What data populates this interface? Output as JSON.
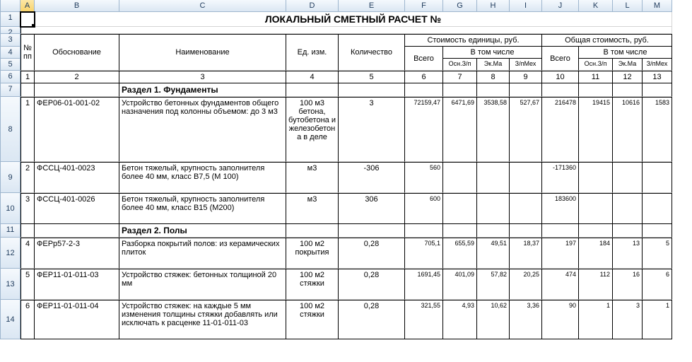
{
  "cols": [
    "A",
    "B",
    "C",
    "D",
    "E",
    "F",
    "G",
    "H",
    "I",
    "J",
    "K",
    "L",
    "M"
  ],
  "active_col": "A",
  "title": "ЛОКАЛЬНЫЙ СМЕТНЫЙ РАСЧЕТ №",
  "headers": {
    "num": "№ пп",
    "just": "Обоснование",
    "name": "Наименование",
    "unit": "Ед. изм.",
    "qty": "Количество",
    "cost_unit": "Стоимость единицы, руб.",
    "cost_total": "Общая стоимость, руб.",
    "total": "Всего",
    "incl": "В том числе",
    "osn": "Осн.З/п",
    "ekm": "Эк.Ма",
    "zpm": "З/пМех"
  },
  "colnums": [
    "1",
    "2",
    "3",
    "4",
    "5",
    "6",
    "7",
    "8",
    "9",
    "10",
    "11",
    "12",
    "13"
  ],
  "section1": "Раздел 1. Фундаменты",
  "section2": "Раздел 2. Полы",
  "rows": [
    {
      "n": "1",
      "code": "ФЕР06-01-001-02",
      "name": "Устройство бетонных фундаментов общего назначения под колонны объемом: до 3 м3",
      "unit": "100 м3 бетона, бутобетона и железобетона в деле",
      "qty": "3",
      "v6": "72159,47",
      "v7": "6471,69",
      "v8": "3538,58",
      "v9": "527,67",
      "v10": "216478",
      "v11": "19415",
      "v12": "10616",
      "v13": "1583"
    },
    {
      "n": "2",
      "code": "ФССЦ-401-0023",
      "name": "Бетон тяжелый, крупность заполнителя более 40 мм, класс В7,5 (М 100)",
      "unit": "м3",
      "qty": "-306",
      "v6": "560",
      "v7": "",
      "v8": "",
      "v9": "",
      "v10": "-171360",
      "v11": "",
      "v12": "",
      "v13": ""
    },
    {
      "n": "3",
      "code": "ФССЦ-401-0026",
      "name": "Бетон тяжелый, крупность заполнителя более 40 мм, класс В15 (М200)",
      "unit": "м3",
      "qty": "306",
      "v6": "600",
      "v7": "",
      "v8": "",
      "v9": "",
      "v10": "183600",
      "v11": "",
      "v12": "",
      "v13": ""
    },
    {
      "n": "4",
      "code": "ФЕРр57-2-3",
      "name": "Разборка покрытий полов: из керамических плиток",
      "unit": "100 м2 покрытия",
      "qty": "0,28",
      "v6": "705,1",
      "v7": "655,59",
      "v8": "49,51",
      "v9": "18,37",
      "v10": "197",
      "v11": "184",
      "v12": "13",
      "v13": "5"
    },
    {
      "n": "5",
      "code": "ФЕР11-01-011-03",
      "name": "Устройство стяжек: бетонных толщиной 20 мм",
      "unit": "100 м2 стяжки",
      "qty": "0,28",
      "v6": "1691,45",
      "v7": "401,09",
      "v8": "57,82",
      "v9": "20,25",
      "v10": "474",
      "v11": "112",
      "v12": "16",
      "v13": "6"
    },
    {
      "n": "6",
      "code": "ФЕР11-01-011-04",
      "name": "Устройство стяжек: на каждые 5 мм изменения толщины стяжки добавлять или исключать к расценке 11-01-011-03",
      "unit": "100 м2 стяжки",
      "qty": "0,28",
      "v6": "321,55",
      "v7": "4,93",
      "v8": "10,62",
      "v9": "3,36",
      "v10": "90",
      "v11": "1",
      "v12": "3",
      "v13": "1"
    }
  ]
}
